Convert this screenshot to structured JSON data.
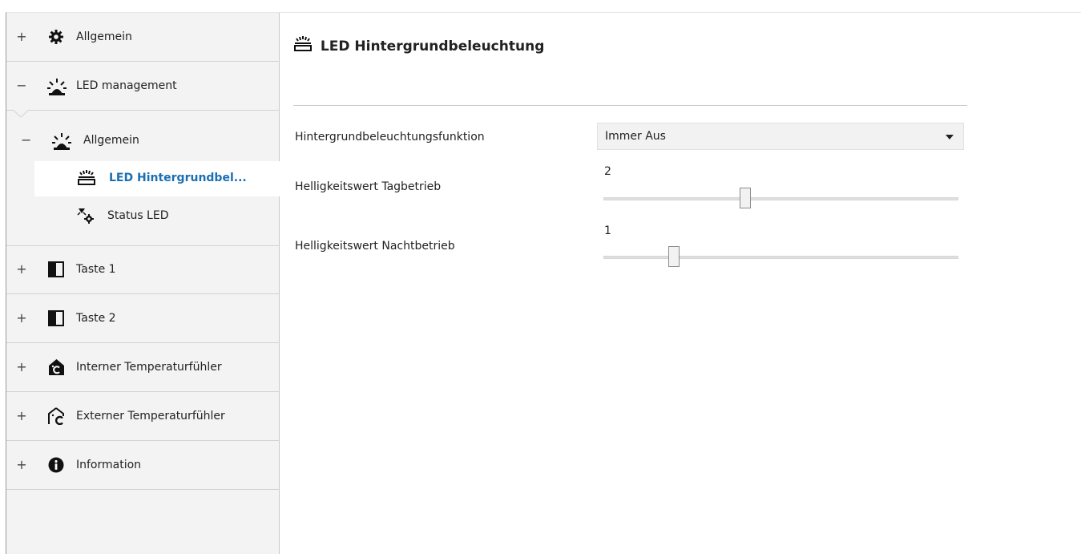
{
  "sidebar": {
    "items": [
      {
        "toggle": "+",
        "label": "Allgemein",
        "icon": "gear-icon"
      },
      {
        "toggle": "−",
        "label": "LED management",
        "icon": "led-burst-icon"
      },
      {
        "toggle": "+",
        "label": "Taste 1",
        "icon": "button-half-icon"
      },
      {
        "toggle": "+",
        "label": "Taste 2",
        "icon": "button-half-icon"
      },
      {
        "toggle": "+",
        "label": "Interner Temperaturfühler",
        "icon": "house-temp-filled-icon"
      },
      {
        "toggle": "+",
        "label": "Externer Temperaturfühler",
        "icon": "house-temp-outline-icon"
      },
      {
        "toggle": "+",
        "label": "Information",
        "icon": "info-icon"
      }
    ],
    "sub": {
      "toggle": "−",
      "label": "Allgemein",
      "icon": "led-burst-icon",
      "children": [
        {
          "label": "LED Hintergrundbel...",
          "icon": "backlight-icon",
          "active": true
        },
        {
          "label": "Status LED",
          "icon": "status-led-gear-icon",
          "active": false
        }
      ]
    }
  },
  "main": {
    "title": "LED Hintergrundbeleuchtung",
    "title_icon": "backlight-icon",
    "fields": {
      "function": {
        "label": "Hintergrundbeleuchtungsfunktion",
        "value": "Immer Aus"
      },
      "day": {
        "label": "Helligkeitswert Tagbetrieb",
        "value": "2"
      },
      "night": {
        "label": "Helligkeitswert Nachtbetrieb",
        "value": "1"
      }
    }
  },
  "colors": {
    "accent": "#1a6fb3",
    "sidebar_bg": "#f3f3f3"
  }
}
